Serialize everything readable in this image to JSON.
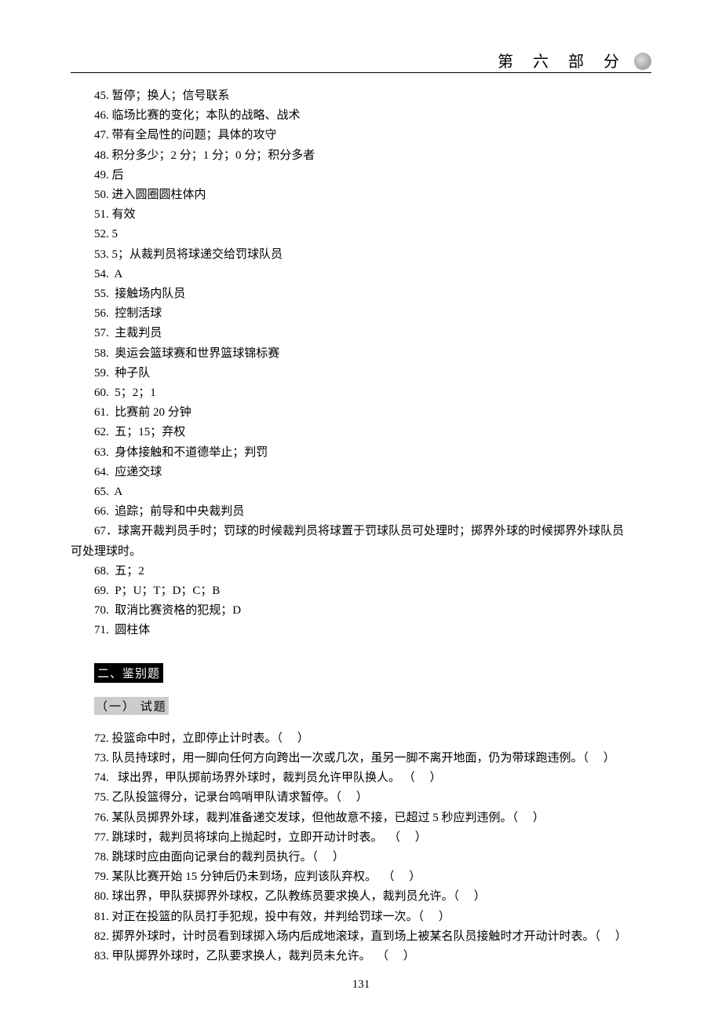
{
  "header": {
    "title": "第 六 部 分"
  },
  "answers": [
    {
      "n": "45.",
      "t": "暂停；换人；信号联系"
    },
    {
      "n": "46.",
      "t": "临场比赛的变化；本队的战略、战术"
    },
    {
      "n": "47.",
      "t": "带有全局性的问题；具体的攻守"
    },
    {
      "n": "48.",
      "t": "积分多少；2 分；1 分；0 分；积分多者"
    },
    {
      "n": "49.",
      "t": "后"
    },
    {
      "n": "50.",
      "t": "进入圆圈圆柱体内"
    },
    {
      "n": "51.",
      "t": "有效"
    },
    {
      "n": "52.",
      "t": "5"
    },
    {
      "n": "53.",
      "t": "5；从裁判员将球递交给罚球队员"
    },
    {
      "n": "54.",
      "t": " A"
    },
    {
      "n": "55.",
      "t": " 接触场内队员"
    },
    {
      "n": "56.",
      "t": " 控制活球"
    },
    {
      "n": "57.",
      "t": " 主裁判员"
    },
    {
      "n": "58.",
      "t": " 奥运会篮球赛和世界篮球锦标赛"
    },
    {
      "n": "59.",
      "t": " 种子队"
    },
    {
      "n": "60.",
      "t": " 5；2；1"
    },
    {
      "n": "61.",
      "t": " 比赛前 20 分钟"
    },
    {
      "n": "62.",
      "t": " 五；15；弃权"
    },
    {
      "n": "63.",
      "t": " 身体接触和不道德举止；判罚"
    },
    {
      "n": "64.",
      "t": " 应递交球"
    },
    {
      "n": "65.",
      "t": " A"
    },
    {
      "n": "66.",
      "t": " 追踪；前导和中央裁判员"
    }
  ],
  "answer67_line1": "67．球离开裁判员手时；罚球的时候裁判员将球置于罚球队员可处理时；掷界外球的时候掷界外球队员",
  "answer67_line2": "可处理球时。",
  "answers_b": [
    {
      "n": "68.",
      "t": " 五；2"
    },
    {
      "n": "69.",
      "t": " P；U；T；D；C；B"
    },
    {
      "n": "70.",
      "t": " 取消比赛资格的犯规；D"
    },
    {
      "n": "71.",
      "t": " 圆柱体"
    }
  ],
  "section2": "二、鉴别题",
  "subsection": "（一） 试题",
  "questions": [
    {
      "n": "72.",
      "t": "投篮命中时，立即停止计时表。（     ）"
    },
    {
      "n": "73.",
      "t": "队员持球时，用一脚向任何方向跨出一次或几次，虽另一脚不离开地面，仍为带球跑违例。（     ）"
    },
    {
      "n": "74.",
      "t": "  球出界，甲队掷前场界外球时，裁判员允许甲队换人。 （     ）"
    },
    {
      "n": "75.",
      "t": "乙队投篮得分，记录台鸣哨甲队请求暂停。（     ）"
    },
    {
      "n": "76.",
      "t": "某队员掷界外球，裁判准备递交发球，但他故意不接，已超过 5 秒应判违例。（     ）"
    },
    {
      "n": "77.",
      "t": "跳球时，裁判员将球向上抛起时，立即开动计时表。  （     ）"
    },
    {
      "n": "78.",
      "t": "跳球时应由面向记录台的裁判员执行。（     ）"
    },
    {
      "n": "79.",
      "t": "某队比赛开始 15 分钟后仍未到场，应判该队弃权。  （     ）"
    },
    {
      "n": "80.",
      "t": "球出界，甲队获掷界外球权，乙队教练员要求换人，裁判员允许。（     ）"
    },
    {
      "n": "81.",
      "t": "对正在投篮的队员打手犯规，投中有效，并判给罚球一次。（     ）"
    },
    {
      "n": "82.",
      "t": "掷界外球时，计时员看到球掷入场内后成地滚球，直到场上被某名队员接触时才开动计时表。（     ）"
    },
    {
      "n": "83.",
      "t": "甲队掷界外球时，乙队要求换人，裁判员未允许。  （     ）"
    }
  ],
  "pagenum": "131"
}
